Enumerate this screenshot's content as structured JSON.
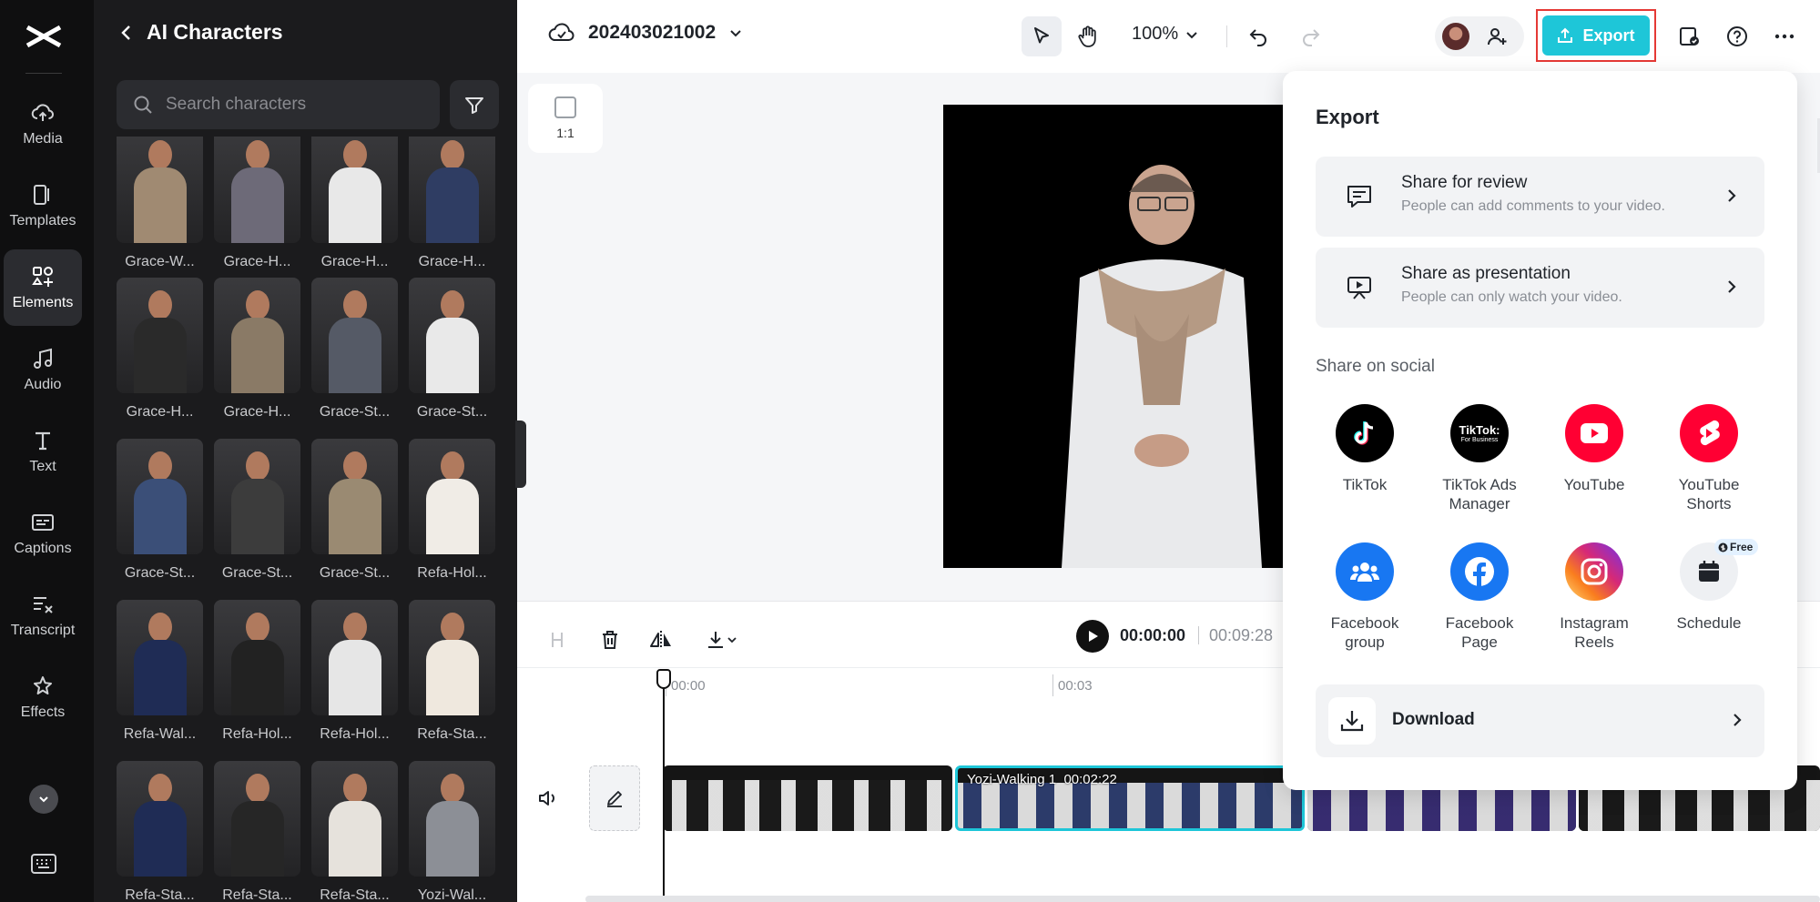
{
  "rail": {
    "items": [
      {
        "label": "Media",
        "icon": "cloud-upload-icon"
      },
      {
        "label": "Templates",
        "icon": "templates-icon"
      },
      {
        "label": "Elements",
        "icon": "elements-icon",
        "active": true
      },
      {
        "label": "Audio",
        "icon": "music-note-icon"
      },
      {
        "label": "Text",
        "icon": "text-icon"
      },
      {
        "label": "Captions",
        "icon": "captions-icon"
      },
      {
        "label": "Transcript",
        "icon": "transcript-icon"
      },
      {
        "label": "Effects",
        "icon": "effects-icon"
      }
    ]
  },
  "panel": {
    "title": "AI Characters",
    "search_placeholder": "Search characters",
    "characters": [
      "Grace-W...",
      "Grace-H...",
      "Grace-H...",
      "Grace-H...",
      "Grace-H...",
      "Grace-H...",
      "Grace-St...",
      "Grace-St...",
      "Grace-St...",
      "Grace-St...",
      "Grace-St...",
      "Refa-Hol...",
      "Refa-Wal...",
      "Refa-Hol...",
      "Refa-Hol...",
      "Refa-Sta...",
      "Refa-Sta...",
      "Refa-Sta...",
      "Refa-Sta...",
      "Yozi-Wal..."
    ]
  },
  "topbar": {
    "project_name": "202403021002",
    "zoom": "100%",
    "export_label": "Export"
  },
  "canvas": {
    "ratio_label": "1:1"
  },
  "timeline": {
    "current_time": "00:00:00",
    "duration": "00:09:28",
    "ticks": [
      "00:00",
      "00:03"
    ],
    "selected_clip_label": "Yozi-Walking 1",
    "selected_clip_duration": "00:02:22"
  },
  "export": {
    "title": "Export",
    "share_review_title": "Share for review",
    "share_review_sub": "People can add comments to your video.",
    "share_presentation_title": "Share as presentation",
    "share_presentation_sub": "People can only watch your video.",
    "social_title": "Share on social",
    "social": [
      {
        "name": "TikTok",
        "color": "#000000"
      },
      {
        "name": "TikTok Ads Manager",
        "color": "#000000",
        "logo_text": "TikTok:",
        "logo_sub": "For Business"
      },
      {
        "name": "YouTube",
        "color": "#ff0033"
      },
      {
        "name": "YouTube Shorts",
        "color": "#ff0033"
      },
      {
        "name": "Facebook group",
        "color": "#1877f2"
      },
      {
        "name": "Facebook Page",
        "color": "#1877f2"
      },
      {
        "name": "Instagram Reels",
        "color": "#e1306c"
      },
      {
        "name": "Schedule",
        "color": "#eef0f3",
        "badge": "Free"
      }
    ],
    "download_label": "Download"
  }
}
